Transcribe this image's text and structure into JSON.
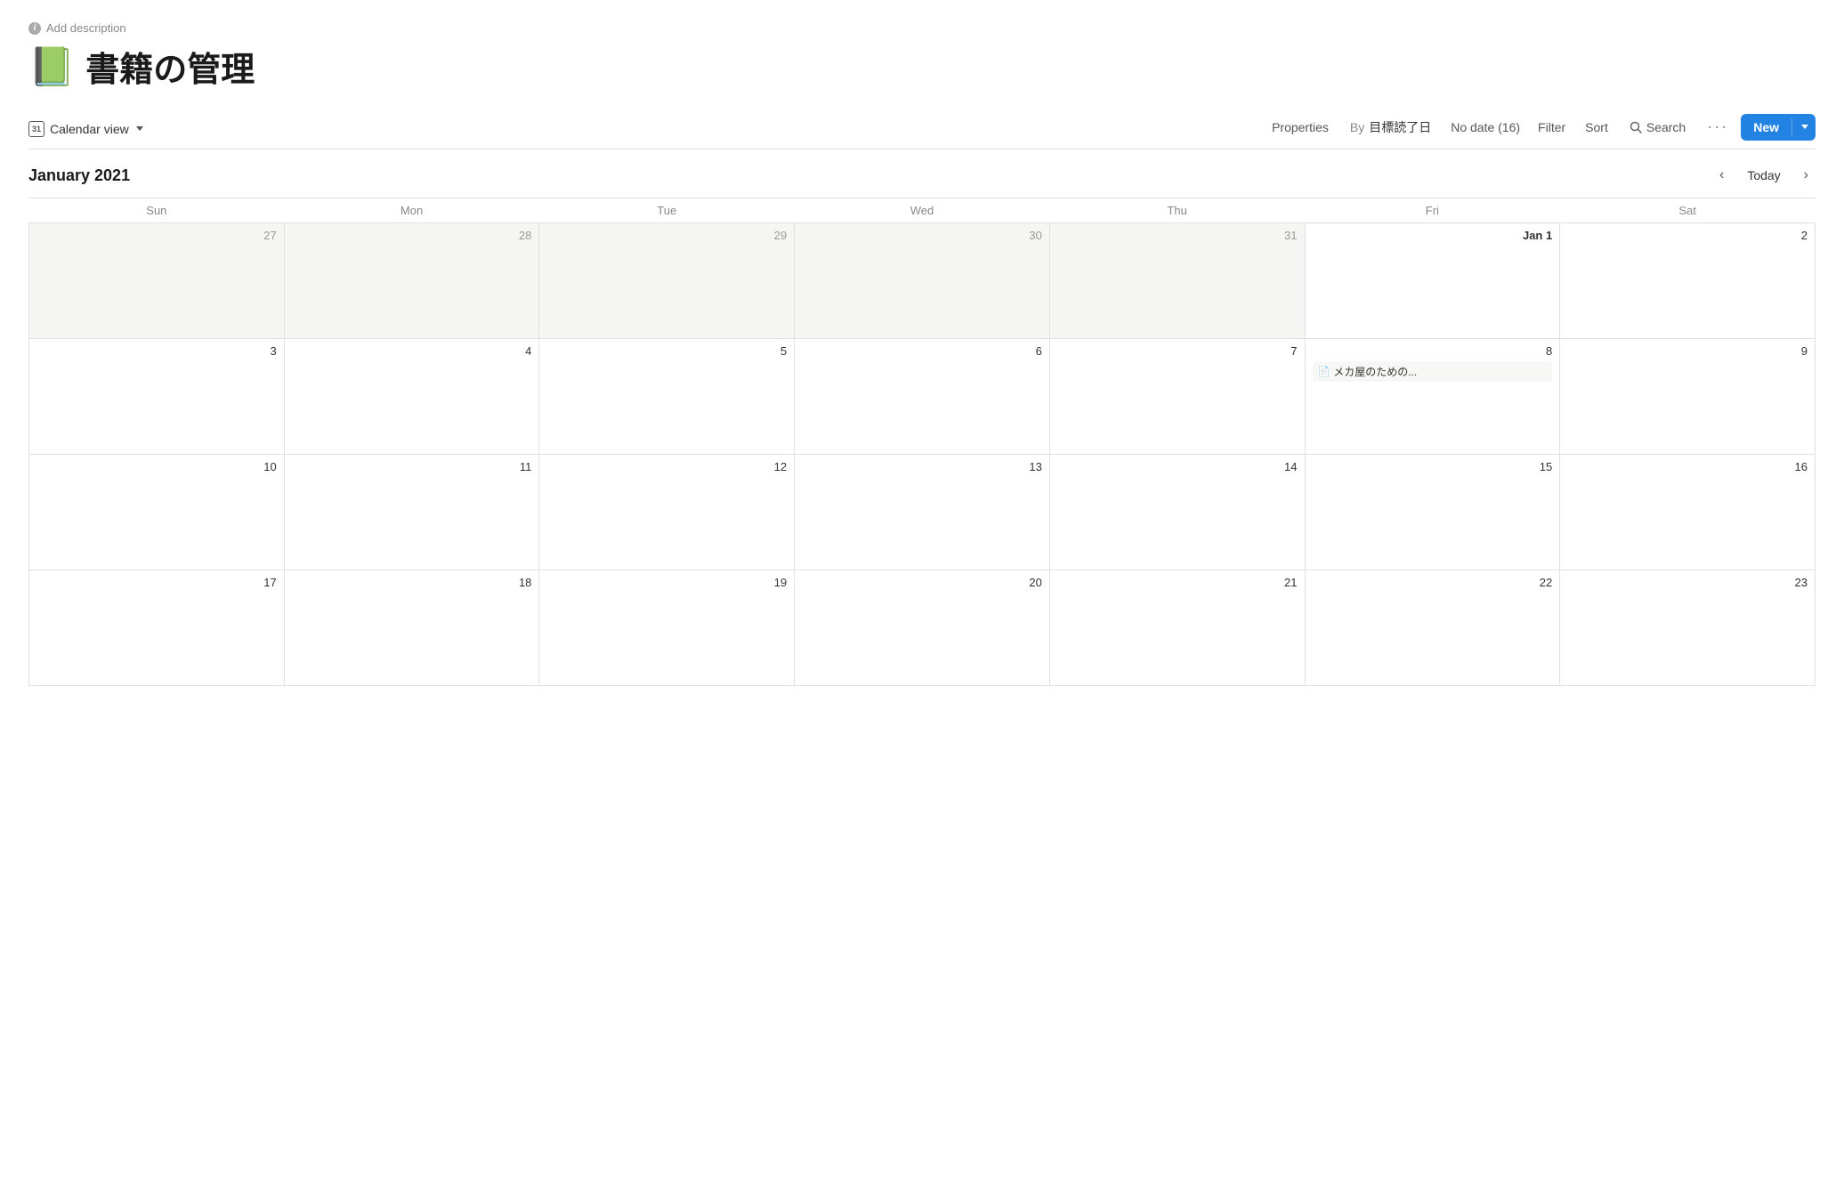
{
  "page": {
    "add_description": "Add description",
    "emoji": "📗",
    "title": "書籍の管理"
  },
  "toolbar": {
    "view_label": "Calendar view",
    "properties_label": "Properties",
    "by_label": "By",
    "by_value": "目標読了日",
    "no_date_label": "No date (16)",
    "filter_label": "Filter",
    "sort_label": "Sort",
    "search_label": "Search",
    "more_label": "···",
    "new_label": "New"
  },
  "calendar": {
    "month_year": "January 2021",
    "today_label": "Today",
    "prev_label": "‹",
    "next_label": "›",
    "weekdays": [
      "Sun",
      "Mon",
      "Tue",
      "Wed",
      "Thu",
      "Fri",
      "Sat"
    ],
    "weeks": [
      [
        {
          "day": "27",
          "outside": true
        },
        {
          "day": "28",
          "outside": true
        },
        {
          "day": "29",
          "outside": true
        },
        {
          "day": "30",
          "outside": true
        },
        {
          "day": "31",
          "outside": true
        },
        {
          "day": "Jan 1",
          "outside": false,
          "special": true
        },
        {
          "day": "2",
          "outside": false
        }
      ],
      [
        {
          "day": "3",
          "outside": false
        },
        {
          "day": "4",
          "outside": false
        },
        {
          "day": "5",
          "outside": false
        },
        {
          "day": "6",
          "outside": false
        },
        {
          "day": "7",
          "outside": false
        },
        {
          "day": "8",
          "outside": false,
          "entry": "メカ屋のための..."
        },
        {
          "day": "9",
          "outside": false
        }
      ],
      [
        {
          "day": "10",
          "outside": false
        },
        {
          "day": "11",
          "outside": false
        },
        {
          "day": "12",
          "outside": false
        },
        {
          "day": "13",
          "outside": false
        },
        {
          "day": "14",
          "outside": false
        },
        {
          "day": "15",
          "outside": false
        },
        {
          "day": "16",
          "outside": false
        }
      ],
      [
        {
          "day": "17",
          "outside": false
        },
        {
          "day": "18",
          "outside": false
        },
        {
          "day": "19",
          "outside": false
        },
        {
          "day": "20",
          "outside": false
        },
        {
          "day": "21",
          "outside": false
        },
        {
          "day": "22",
          "outside": false
        },
        {
          "day": "23",
          "outside": false
        }
      ]
    ]
  }
}
